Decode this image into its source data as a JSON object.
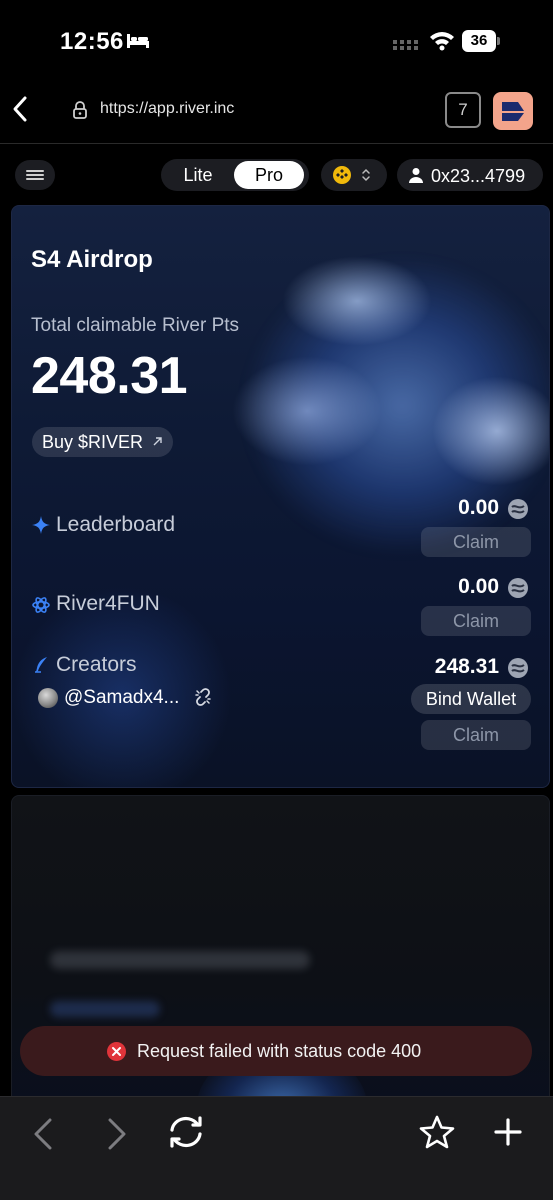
{
  "status_bar": {
    "time": "12:56",
    "battery": "36"
  },
  "browser": {
    "url": "https://app.river.inc",
    "tabs_count": "7"
  },
  "header": {
    "mode_lite": "Lite",
    "mode_pro": "Pro",
    "active_mode": "Pro",
    "wallet_address": "0x23...4799"
  },
  "airdrop": {
    "title": "S4 Airdrop",
    "claimable_label": "Total claimable River Pts",
    "claimable_value": "248.31",
    "buy_label": "Buy $RIVER",
    "rows": [
      {
        "label": "Leaderboard",
        "value": "0.00",
        "claim_label": "Claim"
      },
      {
        "label": "River4FUN",
        "value": "0.00",
        "claim_label": "Claim"
      },
      {
        "label": "Creators",
        "value": "248.31",
        "claim_label": "Claim",
        "handle": "@Samadx4...",
        "bind_label": "Bind Wallet"
      }
    ]
  },
  "toast": {
    "message": "Request failed with status code 400"
  },
  "colors": {
    "accent_blue": "#3b82f6",
    "toast_bg": "#3a1a1c",
    "error_red": "#e0343a",
    "brand_peach": "#f3a48b"
  }
}
